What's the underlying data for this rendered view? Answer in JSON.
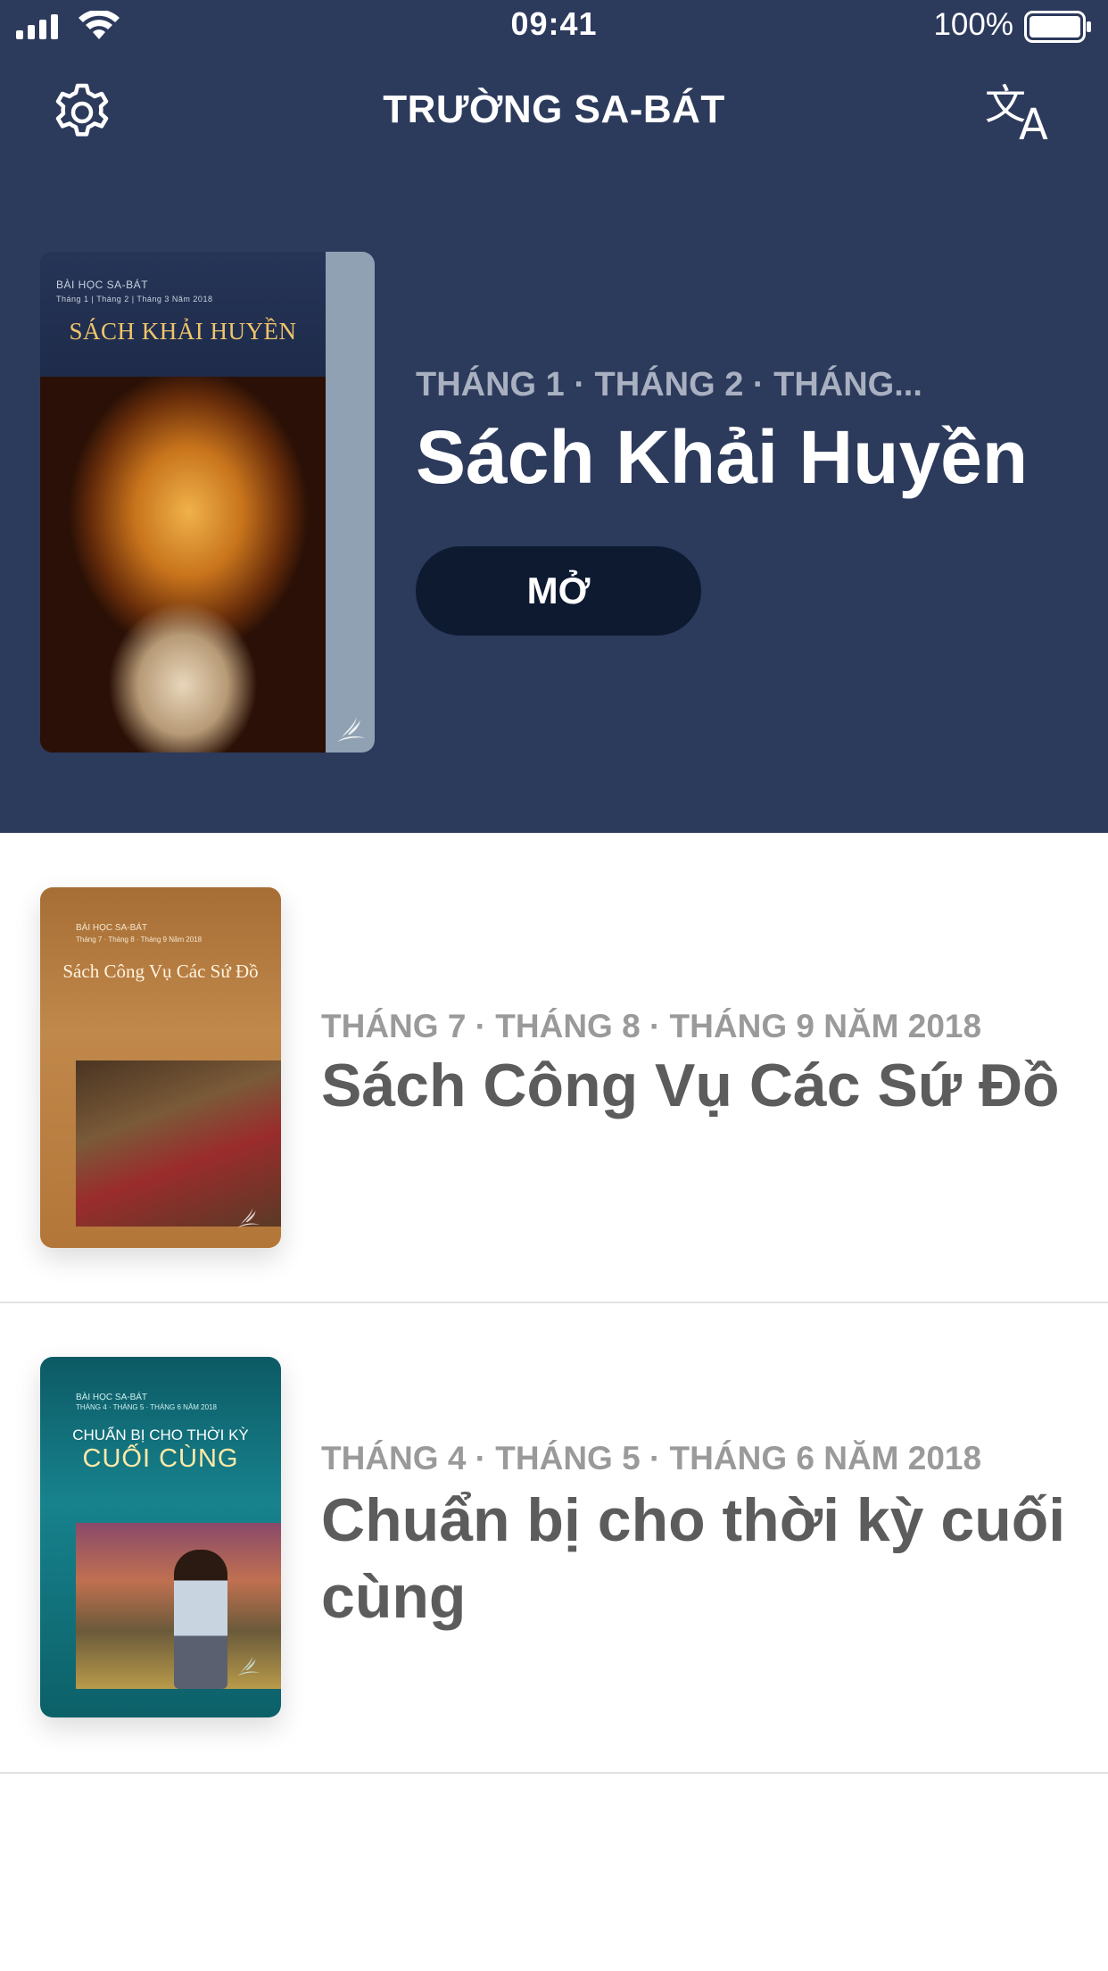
{
  "status": {
    "time": "09:41",
    "battery": "100%"
  },
  "header": {
    "title": "TRƯỜNG SA-BÁT",
    "translate_glyph_1": "文",
    "translate_glyph_2": "A"
  },
  "featured": {
    "cover_header": "BÀI HỌC SA-BÁT",
    "cover_dates": "Tháng 1 | Tháng 2 | Tháng 3 Năm 2018",
    "cover_title": "SÁCH KHẢI HUYỀN",
    "quarter": "THÁNG 1 · THÁNG 2 · THÁNG...",
    "title": "Sách Khải Huyền",
    "open_label": "MỞ"
  },
  "lessons": [
    {
      "cover_header": "BÀI HỌC SA-BÁT",
      "cover_dates": "Tháng 7 · Tháng 8 · Tháng 9 Năm 2018",
      "cover_title": "Sách Công Vụ Các Sứ Đồ",
      "quarter": "THÁNG 7 · THÁNG 8 · THÁNG 9 NĂM 2018",
      "title": "Sách Công Vụ Các Sứ Đồ"
    },
    {
      "cover_header": "BÀI HỌC SA-BÁT",
      "cover_dates": "THÁNG 4 · THÁNG 5 · THÁNG 6 NĂM 2018",
      "cover_title_line1": "CHUẨN BỊ CHO THỜI KỲ",
      "cover_title_line2": "CUỐI CÙNG",
      "quarter": "THÁNG 4 · THÁNG 5 · THÁNG 6 NĂM 2018",
      "title": "Chuẩn bị cho thời kỳ cuối cùng"
    }
  ],
  "colors": {
    "header_bg": "#2c3a5c",
    "button_bg": "#0d1a30",
    "list_title": "#5c5c5c",
    "list_sub": "#9a9a9a"
  }
}
